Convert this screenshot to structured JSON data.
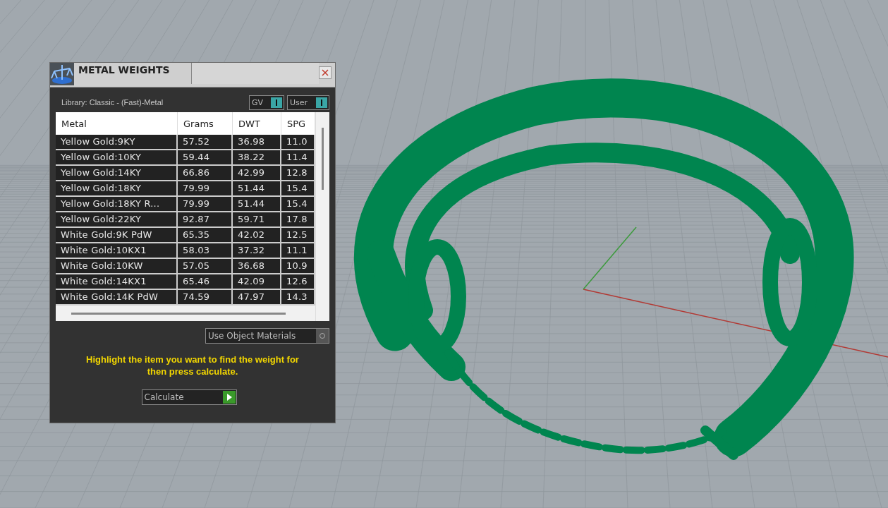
{
  "window": {
    "title": "METAL WEIGHTS"
  },
  "library": "Library: Classic - (Fast)-Metal",
  "toggles": [
    {
      "label": "GV",
      "on": true
    },
    {
      "label": "User",
      "on": true
    }
  ],
  "table": {
    "columns": [
      "Metal",
      "Grams",
      "DWT",
      "SPG"
    ],
    "rows": [
      [
        "Yellow Gold:9KY",
        "57.52",
        "36.98",
        "11.0"
      ],
      [
        "Yellow Gold:10KY",
        "59.44",
        "38.22",
        "11.4"
      ],
      [
        "Yellow Gold:14KY",
        "66.86",
        "42.99",
        "12.8"
      ],
      [
        "Yellow Gold:18KY",
        "79.99",
        "51.44",
        "15.4"
      ],
      [
        "Yellow Gold:18KY R...",
        "79.99",
        "51.44",
        "15.4"
      ],
      [
        "Yellow Gold:22KY",
        "92.87",
        "59.71",
        "17.8"
      ],
      [
        "White Gold:9K PdW",
        "65.35",
        "42.02",
        "12.5"
      ],
      [
        "White Gold:10KX1",
        "58.03",
        "37.32",
        "11.1"
      ],
      [
        "White Gold:10KW",
        "57.05",
        "36.68",
        "10.9"
      ],
      [
        "White Gold:14KX1",
        "65.46",
        "42.09",
        "12.6"
      ],
      [
        "White Gold:14K PdW",
        "74.59",
        "47.97",
        "14.3"
      ]
    ]
  },
  "use_object_materials": {
    "label": "Use Object Materials",
    "checked": false
  },
  "hint": "Highlight the item you want to find the weight for then press calculate.",
  "calculate_button": "Calculate"
}
